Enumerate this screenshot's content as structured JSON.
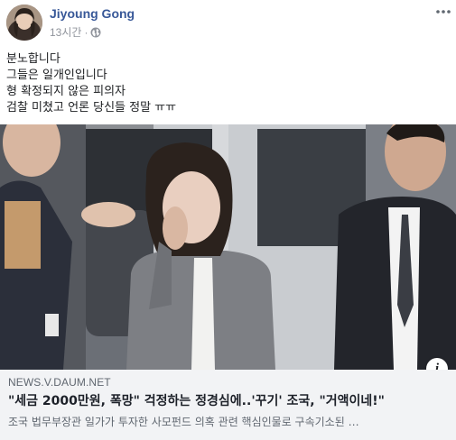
{
  "post": {
    "author": "Jiyoung Gong",
    "time": "13시간",
    "separator": "·",
    "privacy_icon": "globe-icon",
    "more_icon": "more-options-icon",
    "lines": [
      "분노합니다",
      "그들은 일개인입니다",
      "형 확정되지 않은 피의자",
      "검찰 미쳤고 언론 당신들 정말 ㅠㅠ"
    ]
  },
  "link": {
    "domain": "NEWS.V.DAUM.NET",
    "title": "\"세금 2000만원, 폭망\" 걱정하는 정경심에..'꾸기' 조국, \"거액이네!\"",
    "description": "조국 법무부장관 일가가 투자한 사모펀드 의혹 관련 핵심인물로 구속기소된 …",
    "info_icon": "info-icon",
    "info_glyph": "i"
  },
  "colors": {
    "author": "#385898",
    "meta": "#90949c",
    "card_bg": "#f2f3f5",
    "card_meta": "#606770"
  }
}
